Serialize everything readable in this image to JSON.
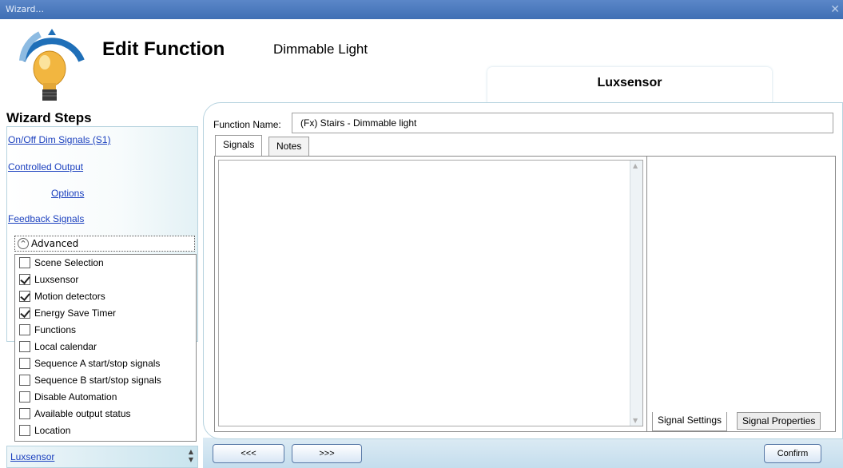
{
  "window": {
    "title": "Wizard...",
    "close_label": "✕"
  },
  "header": {
    "title": "Edit Function",
    "subtitle": "Dimmable Light",
    "current_step": "Luxsensor",
    "icon": "lightbulb-icon"
  },
  "sidebar": {
    "title": "Wizard Steps",
    "links": [
      {
        "label": "On/Off Dim Signals (S1)"
      },
      {
        "label": "Controlled Output"
      },
      {
        "label": "Options"
      },
      {
        "label": "Feedback Signals"
      }
    ],
    "advanced": {
      "label": "Advanced",
      "items": [
        {
          "label": "Scene Selection",
          "checked": false
        },
        {
          "label": "Luxsensor",
          "checked": true
        },
        {
          "label": "Motion detectors",
          "checked": true
        },
        {
          "label": "Energy Save Timer",
          "checked": true
        },
        {
          "label": "Functions",
          "checked": false
        },
        {
          "label": "Local calendar",
          "checked": false
        },
        {
          "label": "Sequence A start/stop signals",
          "checked": false
        },
        {
          "label": "Sequence B start/stop signals",
          "checked": false
        },
        {
          "label": "Disable Automation",
          "checked": false
        },
        {
          "label": "Available output status",
          "checked": false
        },
        {
          "label": "Location",
          "checked": false
        }
      ]
    },
    "bottom_link": "Luxsensor"
  },
  "form": {
    "function_name_label": "Function Name:",
    "function_name_value": "(Fx) Stairs - Dimmable light",
    "tabs": [
      {
        "label": "Signals"
      },
      {
        "label": "Notes"
      }
    ],
    "bottom_tabs": [
      {
        "label": "Signal Settings"
      },
      {
        "label": "Signal Properties"
      }
    ]
  },
  "footer": {
    "prev_label": "<<<",
    "next_label": ">>>",
    "confirm_label": "Confirm"
  },
  "colors": {
    "titlebar": "#4a7cc0",
    "link": "#1a3fbe",
    "panel_border": "#b7d3df"
  }
}
